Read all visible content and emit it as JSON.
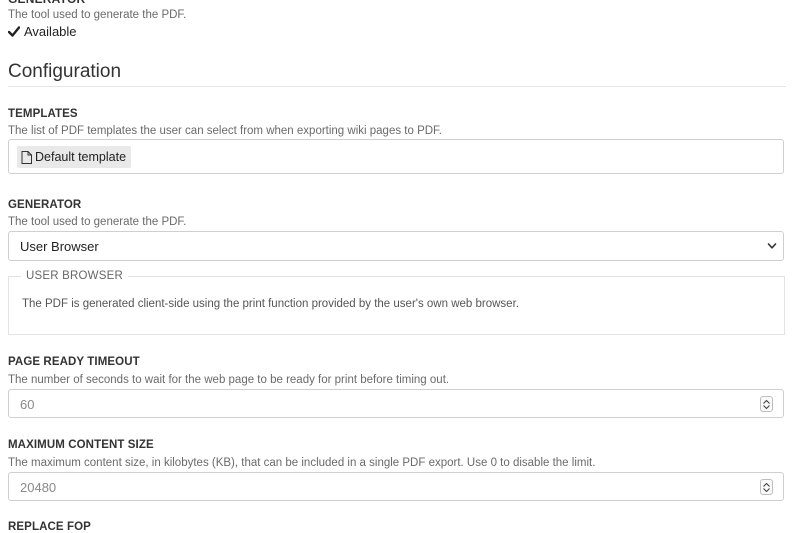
{
  "top_field": {
    "description": "The tool used to generate the PDF.",
    "status": "Available"
  },
  "configuration": {
    "title": "Configuration"
  },
  "templates": {
    "label": "TEMPLATES",
    "description": "The list of PDF templates the user can select from when exporting wiki pages to PDF.",
    "items": [
      {
        "label": "Default template",
        "icon": "document-icon"
      }
    ]
  },
  "generator": {
    "label": "GENERATOR",
    "description": "The tool used to generate the PDF.",
    "selected": "User Browser",
    "details": {
      "legend": "USER BROWSER",
      "text": "The PDF is generated client-side using the print function provided by the user's own web browser."
    }
  },
  "page_ready_timeout": {
    "label": "PAGE READY TIMEOUT",
    "description": "The number of seconds to wait for the web page to be ready for print before timing out.",
    "value": "60"
  },
  "max_content_size": {
    "label": "MAXIMUM CONTENT SIZE",
    "description": "The maximum content size, in kilobytes (KB), that can be included in a single PDF export. Use 0 to disable the limit.",
    "value": "20480"
  },
  "replace_fop": {
    "label": "REPLACE FOP"
  }
}
